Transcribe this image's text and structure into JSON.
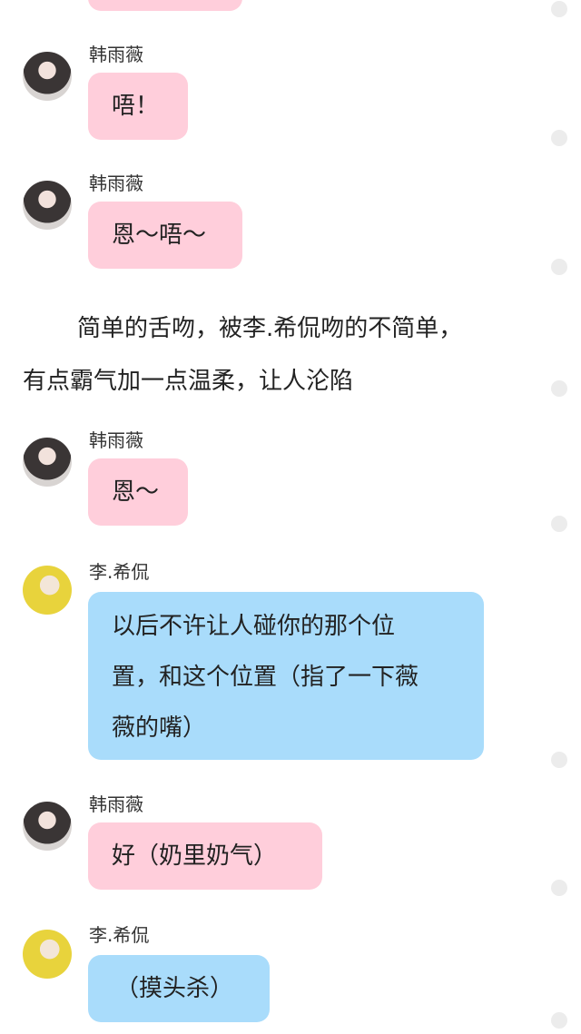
{
  "messages": [
    {
      "sender": "韩雨薇",
      "text": "唔！"
    },
    {
      "sender": "韩雨薇",
      "text": "恩～唔～"
    },
    {
      "sender": "韩雨薇",
      "text": "恩～"
    },
    {
      "sender": "李.希侃",
      "text_lines": [
        "以后不许让人碰你的那个位",
        "置，和这个位置（指了一下薇",
        "薇的嘴）"
      ]
    },
    {
      "sender": "韩雨薇",
      "text": "好（奶里奶气）"
    },
    {
      "sender": "李.希侃",
      "text": "（摸头杀）"
    }
  ],
  "narration": {
    "lines": [
      "简单的舌吻，被李.希侃吻的不简单，",
      "有点霸气加一点温柔，让人沦陷"
    ]
  },
  "colors": {
    "pink_bubble": "#ffcedb",
    "blue_bubble": "#a9dcfb",
    "side_dot": "#ececec"
  }
}
